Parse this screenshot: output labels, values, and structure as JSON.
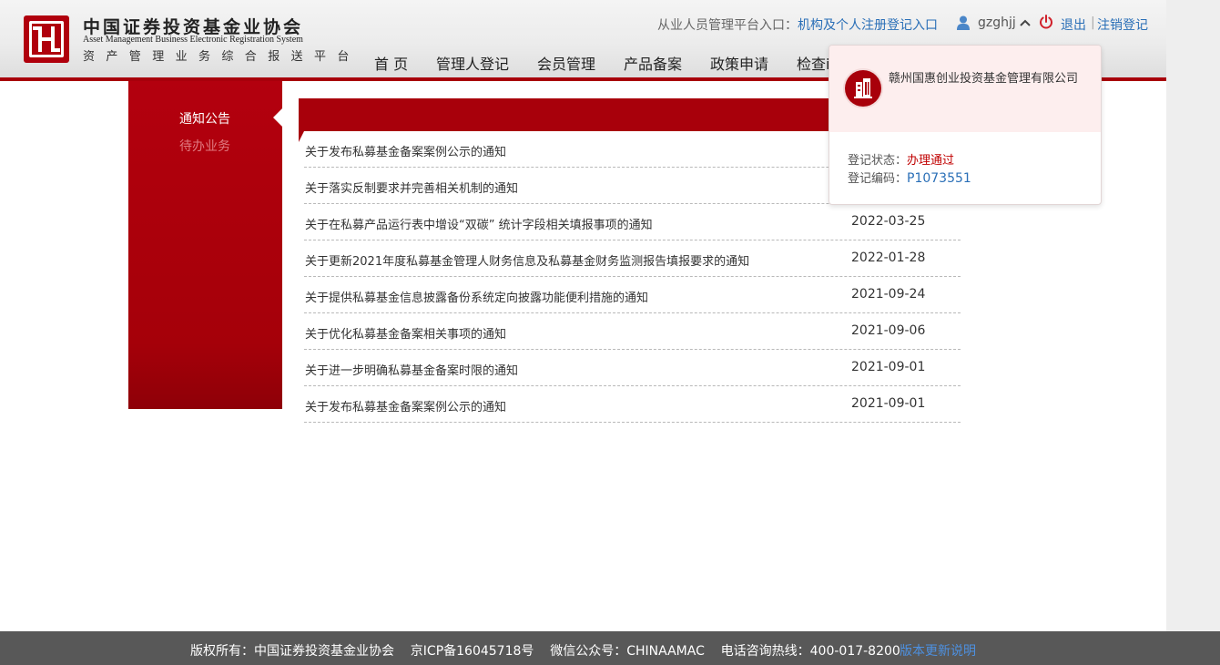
{
  "header": {
    "org_name_cn": "中国证券投资基金业协会",
    "org_name_en": "Asset Management Business Electronic Registration System",
    "platform_name": "资产管理业务综合报送平台",
    "entry_label": "从业人员管理平台入口：",
    "entry_link": "机构及个人注册登记入口",
    "username": "gzghjj",
    "logout": "退出",
    "separator": "|",
    "unregister": "注销登记",
    "icons": [
      "logo-emblem",
      "user-icon",
      "chevron-up-icon",
      "power-icon"
    ]
  },
  "nav": {
    "items": [
      "首 页",
      "管理人登记",
      "会员管理",
      "产品备案",
      "政策申请",
      "检查i"
    ]
  },
  "sidebar": {
    "items": [
      {
        "label": "通知公告",
        "active": true
      },
      {
        "label": "待办业务",
        "active": false
      }
    ]
  },
  "notices": [
    {
      "title": "关于发布私募基金备案案例公示的通知",
      "date": ""
    },
    {
      "title": "关于落实反制要求并完善相关机制的通知",
      "date": ""
    },
    {
      "title": "关于在私募产品运行表中增设“双碳” 统计字段相关填报事项的通知",
      "date": "2022-03-25"
    },
    {
      "title": "关于更新2021年度私募基金管理人财务信息及私募基金财务监测报告填报要求的通知",
      "date": "2022-01-28"
    },
    {
      "title": "关于提供私募基金信息披露备份系统定向披露功能便利措施的通知",
      "date": "2021-09-24"
    },
    {
      "title": "关于优化私募基金备案相关事项的通知",
      "date": "2021-09-06"
    },
    {
      "title": "关于进一步明确私募基金备案时限的通知",
      "date": "2021-09-01"
    },
    {
      "title": "关于发布私募基金备案案例公示的通知",
      "date": "2021-09-01"
    }
  ],
  "popup": {
    "company": "赣州国惠创业投资基金管理有限公司",
    "status_label": "登记状态：",
    "status_value": "办理通过",
    "code_label": "登记编码：",
    "code_value": "P1073551",
    "icon": "building-icon"
  },
  "footer": {
    "text": "版权所有：中国证券投资基金业协会    京ICP备16045718号    微信公众号：CHINAAMAC    电话咨询热线：400-017-8200",
    "link": "版本更新说明"
  },
  "colors": {
    "brand_red": "#a8000b",
    "link_blue": "#2a6fb7",
    "footer_bg": "#585858",
    "popup_bg": "#fdeeee"
  }
}
